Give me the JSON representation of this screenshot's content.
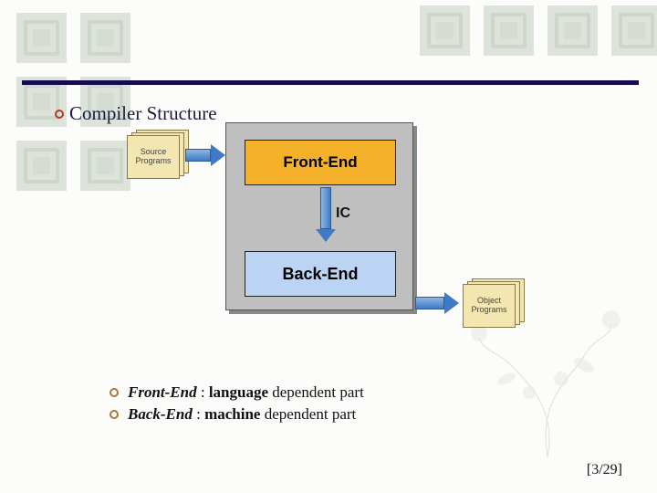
{
  "title": "Compiler Structure",
  "diagram": {
    "source_label": "Source Programs",
    "object_label": "Object Programs",
    "front_end": "Front-End",
    "back_end": "Back-End",
    "intermediate": "IC"
  },
  "definitions": [
    {
      "term": "Front-End",
      "keyword": "language",
      "rest": " dependent part",
      "sep": " : "
    },
    {
      "term": "Back-End",
      "keyword": "machine",
      "rest": " dependent part",
      "sep": "  : "
    }
  ],
  "page_indicator": "[3/29]"
}
